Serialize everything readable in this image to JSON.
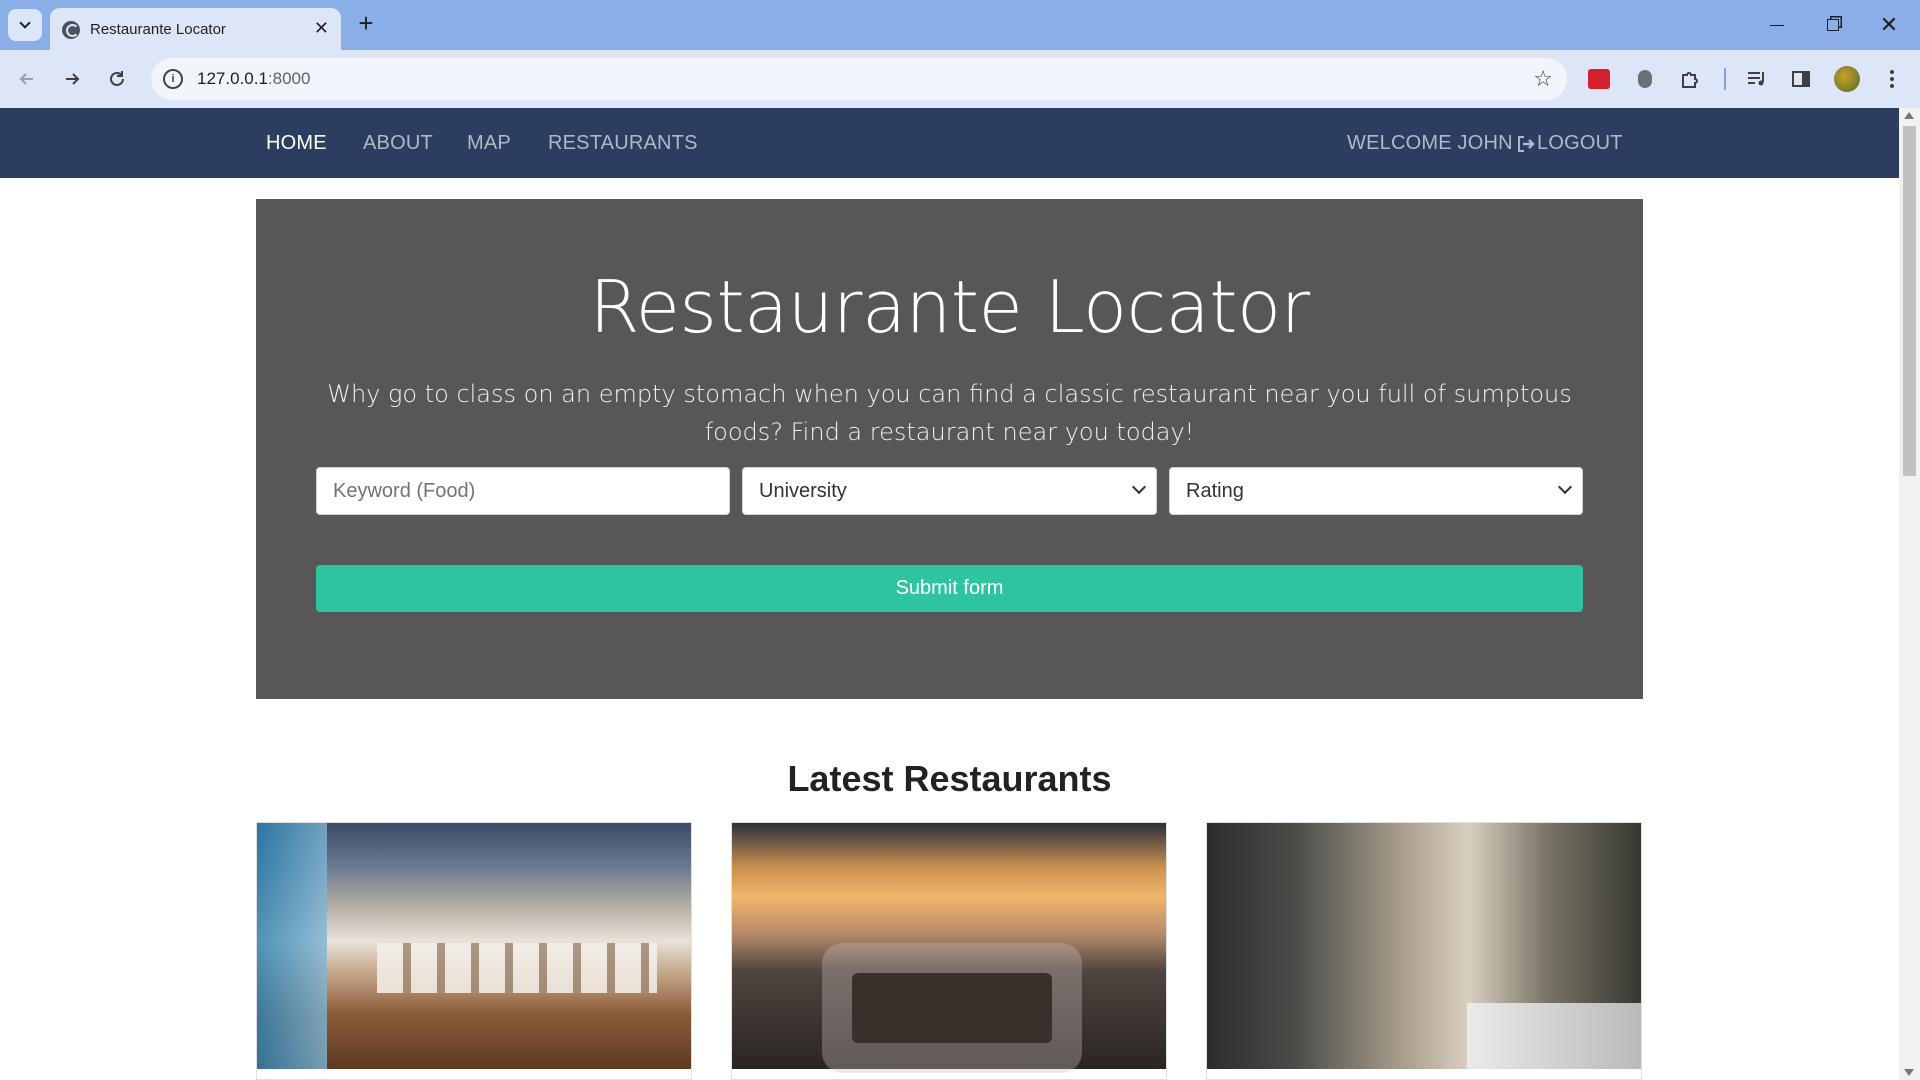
{
  "browser": {
    "tab_title": "Restaurante Locator",
    "tab_close": "✕",
    "new_tab": "+",
    "url_host": "127.0.0.1",
    "url_port": ":8000"
  },
  "navbar": {
    "links": [
      "HOME",
      "ABOUT",
      "MAP",
      "RESTAURANTS"
    ],
    "active": "HOME",
    "welcome": "WELCOME JOHN",
    "logout": "LOGOUT"
  },
  "hero": {
    "title": "Restaurante Locator",
    "lead": "Why go to class on an empty stomach when you can find a classic restaurant near you full of sumptous foods? Find a restaurant near you today!",
    "keyword_placeholder": "Keyword (Food)",
    "university_select": "University",
    "rating_select": "Rating",
    "submit_label": "Submit form"
  },
  "latest": {
    "title": "Latest Restaurants"
  },
  "colors": {
    "navbar_bg": "#2c3e5f",
    "hero_bg": "#575757",
    "submit_bg": "#2ec4a0",
    "tabstrip_bg": "#8aaee8"
  },
  "icons": [
    "search-tabs-icon",
    "globe-favicon-icon",
    "back-icon",
    "forward-icon",
    "reload-icon",
    "site-info-icon",
    "bookmark-star-icon",
    "extension-red-icon",
    "extension-bug-icon",
    "extensions-puzzle-icon",
    "media-control-icon",
    "side-panel-icon",
    "profile-avatar-icon",
    "menu-kebab-icon",
    "logout-icon"
  ]
}
